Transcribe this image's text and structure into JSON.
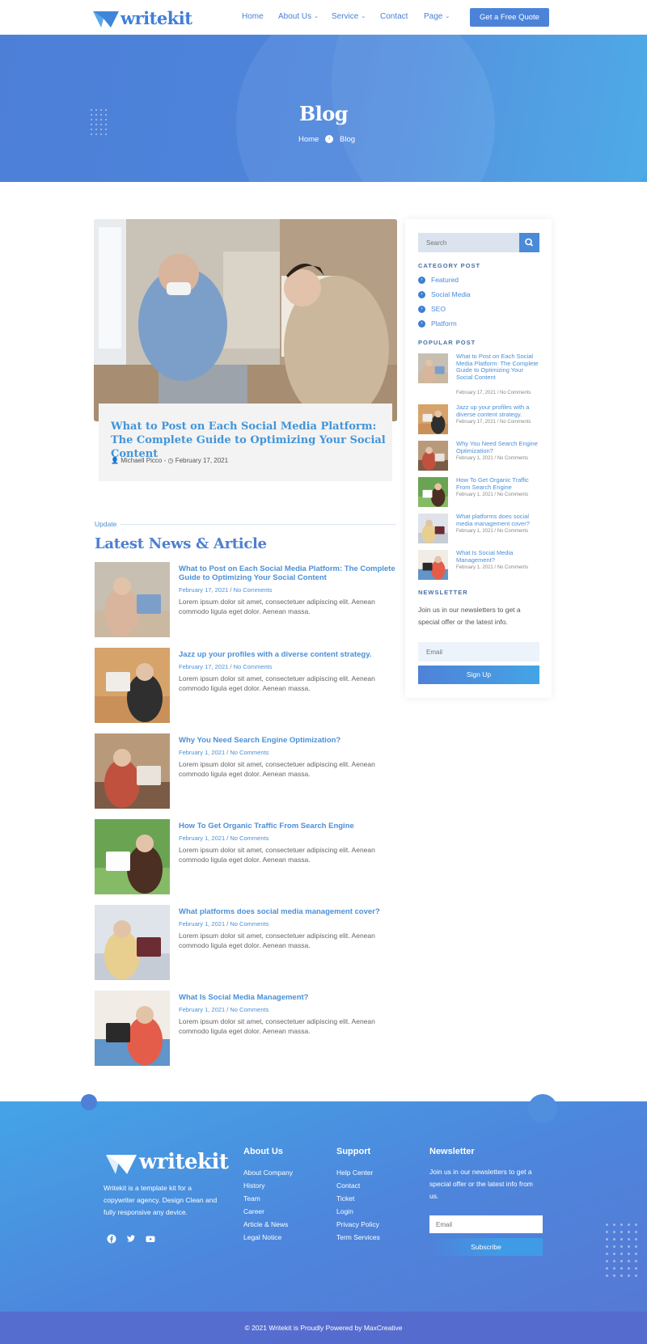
{
  "header": {
    "brand": "writekit",
    "nav": [
      {
        "label": "Home",
        "dropdown": false
      },
      {
        "label": "About Us",
        "dropdown": true
      },
      {
        "label": "Service",
        "dropdown": true
      },
      {
        "label": "Contact",
        "dropdown": false
      },
      {
        "label": "Page",
        "dropdown": true
      }
    ],
    "cta_label": "Get a Free Quote"
  },
  "hero": {
    "title": "Blog",
    "breadcrumb": [
      "Home",
      "Blog"
    ]
  },
  "featured": {
    "title": "What to Post on Each Social Media Platform: The Complete Guide to Optimizing Your Social Content",
    "author": "Michaell Picco",
    "separator": "-",
    "date": "February 17, 2021"
  },
  "latest": {
    "eyebrow": "Update",
    "title": "Latest News & Article",
    "posts": [
      {
        "title": "What to Post on Each Social Media Platform: The Complete Guide to Optimizing Your Social Content",
        "date": "February 17, 2021",
        "comments": "No Comments",
        "excerpt": "Lorem ipsum dolor sit amet, consectetuer adipiscing elit. Aenean commodo ligula eget dolor. Aenean massa."
      },
      {
        "title": "Jazz up your profiles with a diverse content strategy.",
        "date": "February 17, 2021",
        "comments": "No Comments",
        "excerpt": "Lorem ipsum dolor sit amet, consectetuer adipiscing elit. Aenean commodo ligula eget dolor. Aenean massa."
      },
      {
        "title": "Why You Need Search Engine Optimization?",
        "date": "February 1, 2021",
        "comments": "No Comments",
        "excerpt": "Lorem ipsum dolor sit amet, consectetuer adipiscing elit. Aenean commodo ligula eget dolor. Aenean massa."
      },
      {
        "title": "How To Get Organic Traffic From Search Engine",
        "date": "February 1, 2021",
        "comments": "No Comments",
        "excerpt": "Lorem ipsum dolor sit amet, consectetuer adipiscing elit. Aenean commodo ligula eget dolor. Aenean massa."
      },
      {
        "title": "What platforms does social media management cover?",
        "date": "February 1, 2021",
        "comments": "No Comments",
        "excerpt": "Lorem ipsum dolor sit amet, consectetuer adipiscing elit. Aenean commodo ligula eget dolor. Aenean massa."
      },
      {
        "title": "What Is Social Media Management?",
        "date": "February 1, 2021",
        "comments": "No Comments",
        "excerpt": "Lorem ipsum dolor sit amet, consectetuer adipiscing elit. Aenean commodo ligula eget dolor. Aenean massa."
      }
    ]
  },
  "sidebar": {
    "search_placeholder": "Search",
    "category_heading": "CATEGORY POST",
    "categories": [
      "Featured",
      "Social Media",
      "SEO",
      "Platform"
    ],
    "popular_heading": "POPULAR POST",
    "popular": [
      {
        "title": "What to Post on Each Social Media Platform: The Complete Guide to Optimizing Your Social Content",
        "date": "February 17, 2021",
        "comments": "No Comments"
      },
      {
        "title": "Jazz up your profiles with a diverse content strategy.",
        "date": "February 17, 2021",
        "comments": "No Comments"
      },
      {
        "title": "Why You Need Search Engine Optimization?",
        "date": "February 1, 2021",
        "comments": "No Comments"
      },
      {
        "title": "How To Get Organic Traffic From Search Engine",
        "date": "February 1, 2021",
        "comments": "No Comments"
      },
      {
        "title": "What platforms does social media management cover?",
        "date": "February 1, 2021",
        "comments": "No Comments"
      },
      {
        "title": "What Is Social Media Management?",
        "date": "February 1, 2021",
        "comments": "No Comments"
      }
    ],
    "newsletter_heading": "NEWSLETTER",
    "newsletter_text": "Join us in our newsletters to get a special offer or the latest info.",
    "email_placeholder": "Email",
    "signup_label": "Sign Up"
  },
  "footer": {
    "brand": "writekit",
    "description": "Writekit is a template kit for a copywriter agency. Design Clean and fully responsive any device.",
    "social_icons": [
      "facebook-icon",
      "twitter-icon",
      "youtube-icon"
    ],
    "about": {
      "heading": "About Us",
      "links": [
        "About Company",
        "History",
        "Team",
        "Career",
        "Article & News",
        "Legal Notice"
      ]
    },
    "support": {
      "heading": "Support",
      "links": [
        "Help Center",
        "Contact",
        "Ticket",
        "Login",
        "Privacy Policy",
        "Term Services"
      ]
    },
    "newsletter": {
      "heading": "Newsletter",
      "text": "Join us in our newsletters to get a special offer or the latest info from us.",
      "email_placeholder": "Email",
      "subscribe_label": "Subscribe"
    },
    "copyright": "© 2021 Writekit is Proudly Powered by MaxCreative"
  },
  "colors": {
    "brand": "#4c83d9",
    "link": "#4a90d8",
    "footer_gradient_start": "#44a4e6",
    "footer_gradient_end": "#5777d3"
  }
}
